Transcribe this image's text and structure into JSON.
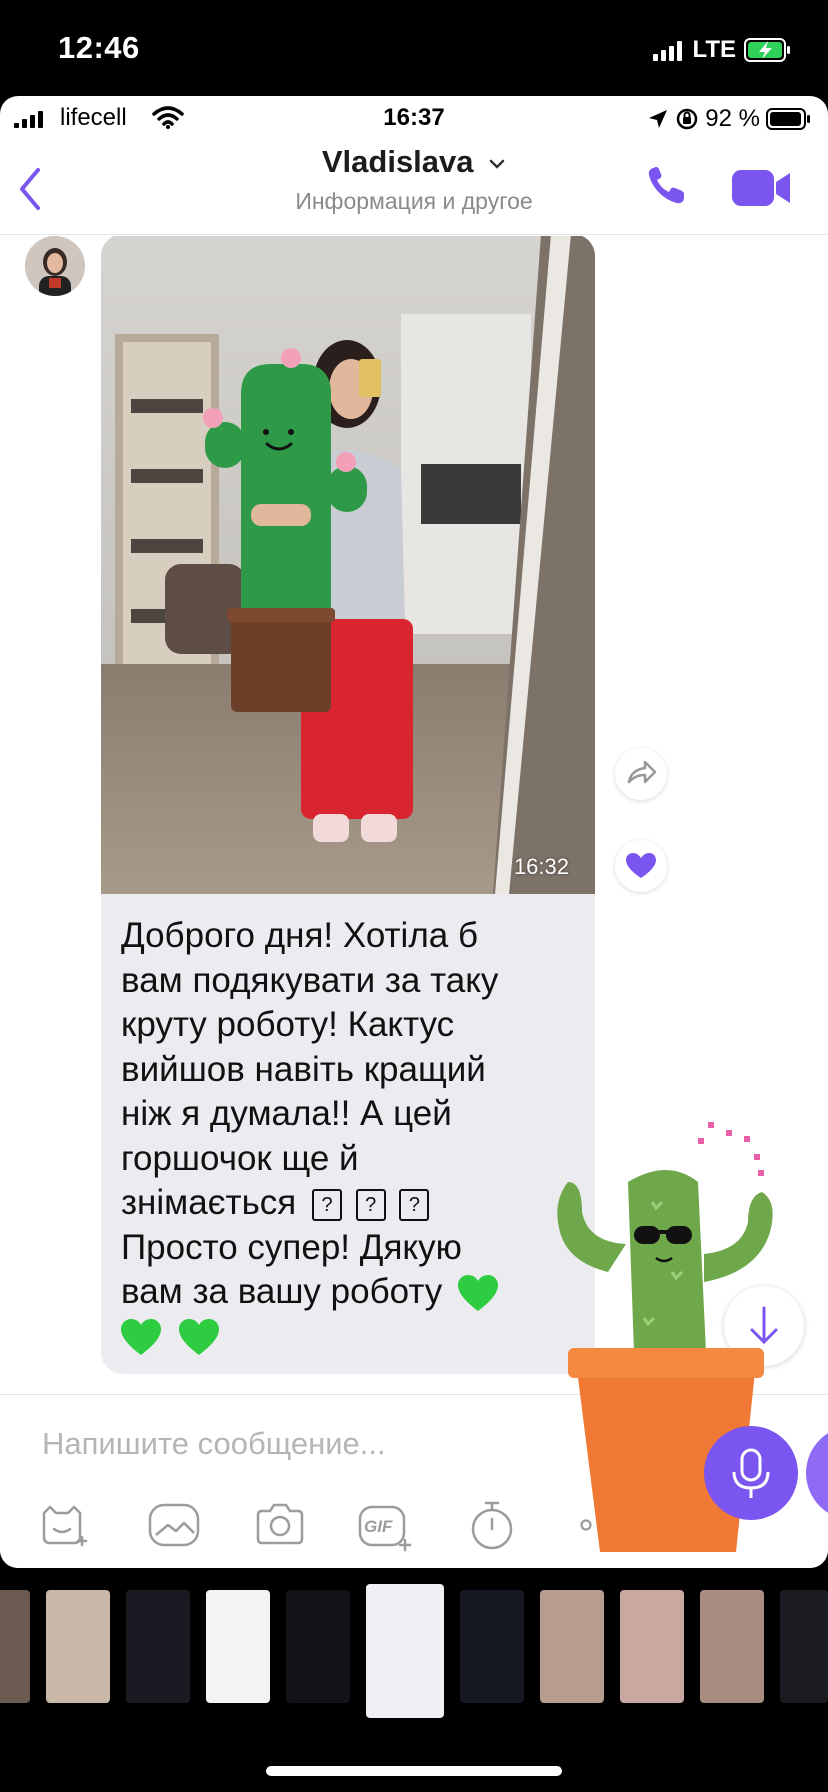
{
  "outer_status": {
    "time": "12:46",
    "network": "LTE"
  },
  "inner_status": {
    "carrier": "lifecell",
    "time": "16:37",
    "battery": "92 %"
  },
  "header": {
    "contact_name": "Vladislava",
    "subtitle": "Информация и другое",
    "back_icon": "chevron-left-icon",
    "call_icon": "phone-icon",
    "video_icon": "video-camera-icon"
  },
  "message": {
    "photo_time": "16:32",
    "text_lines": [
      "Доброго дня! Хотіла б",
      "вам подякувати за таку",
      "круту роботу! Кактус",
      "вийшов навіть кращий",
      "ніж я думала!! А цей",
      "горшочок ще й",
      "знімається",
      "Просто супер! Дякую",
      "вам за вашу роботу",
      ""
    ],
    "missing_glyph": "?"
  },
  "composer": {
    "placeholder": "Напишите сообщение...",
    "tools": [
      "sticker-icon",
      "gallery-icon",
      "camera-icon",
      "gif-icon",
      "timer-icon",
      "more-icon"
    ],
    "gif_label": "GIF"
  },
  "colors": {
    "accent": "#7b55f0",
    "bubble": "#ebebf0",
    "heart_green": "#2ecc40"
  }
}
